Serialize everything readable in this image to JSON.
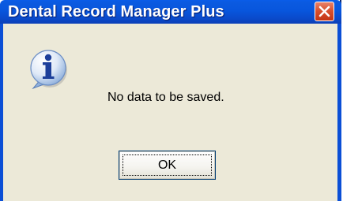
{
  "dialog": {
    "title": "Dental Record Manager Plus",
    "message": "No data to be saved.",
    "ok_label": "OK",
    "icon": "information-icon"
  },
  "colors": {
    "titlebar": "#0856dd",
    "client_background": "#ece9d8",
    "close_button": "#d8512f"
  }
}
